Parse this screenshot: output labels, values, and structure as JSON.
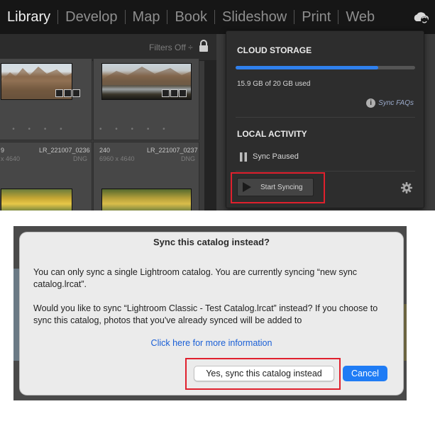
{
  "modules": [
    "Library",
    "Develop",
    "Map",
    "Book",
    "Slideshow",
    "Print",
    "Web"
  ],
  "active_module": "Library",
  "filter_bar": {
    "filters_label": "Filters Off ÷"
  },
  "grid": {
    "cells": [
      {
        "index": "",
        "filename": "LR_221007_0236",
        "dims": "x 4640",
        "type": "DNG",
        "prefix": "9"
      },
      {
        "index": "240",
        "filename": "LR_221007_0237",
        "dims": "6960 x 4640",
        "type": "DNG"
      }
    ]
  },
  "sync_panel": {
    "cloud_title": "CLOUD STORAGE",
    "storage_used_fraction": 0.795,
    "storage_text": "15.9 GB of 20 GB used",
    "faq_label": "Sync FAQs",
    "local_title": "LOCAL ACTIVITY",
    "status_text": "Sync Paused",
    "start_button": "Start Syncing"
  },
  "dialog": {
    "title": "Sync this catalog instead?",
    "paragraph1": "You can only sync a single Lightroom catalog. You are currently syncing “new sync catalog.lrcat”.",
    "paragraph2": "Would you like to sync “Lightroom Classic - Test Catalog.lrcat” instead? If you choose to sync this catalog, photos that you've already synced will be added to",
    "link": "Click here for more information",
    "yes_button": "Yes, sync this catalog instead",
    "cancel_button": "Cancel"
  },
  "colors": {
    "accent": "#2f80ed",
    "highlight": "#e0202d",
    "mac_blue": "#1f7cf5"
  }
}
